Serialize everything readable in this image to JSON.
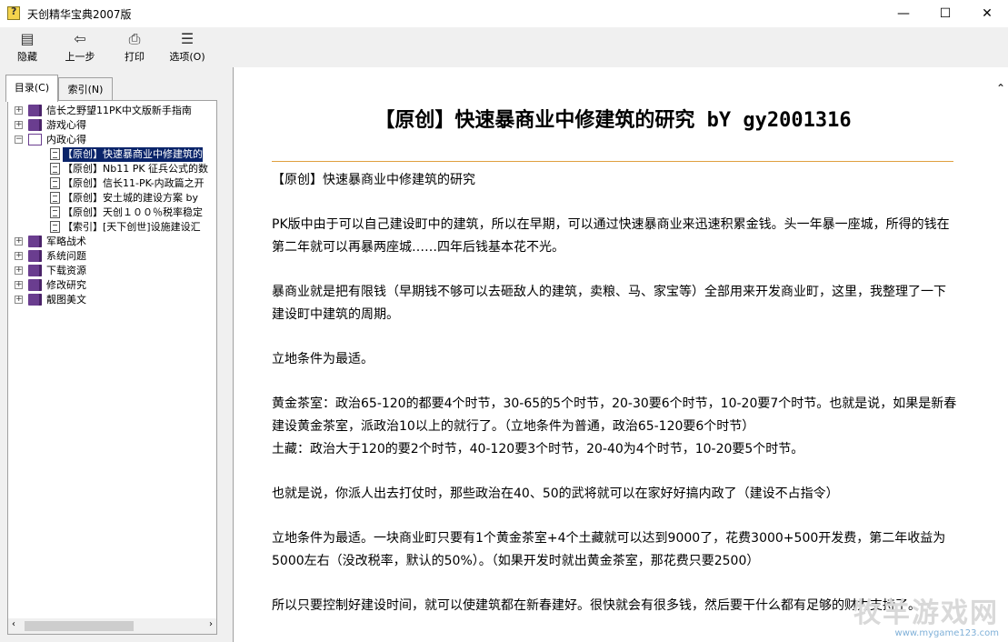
{
  "window": {
    "title": "天创精华宝典2007版",
    "minimize": "—",
    "maximize": "☐",
    "close": "✕"
  },
  "toolbar": [
    {
      "label": "隐藏",
      "icon": "hide-icon",
      "glyph": "▤"
    },
    {
      "label": "上一步",
      "icon": "back-icon",
      "glyph": "⇦"
    },
    {
      "label": "打印",
      "icon": "print-icon",
      "glyph": "⎙"
    },
    {
      "label": "选项(O)",
      "icon": "options-icon",
      "glyph": "☰"
    }
  ],
  "tabs": {
    "contents": "目录(C)",
    "index": "索引(N)"
  },
  "tree": [
    {
      "label": "信长之野望11PK中文版新手指南",
      "type": "book",
      "expanded": false,
      "level": 0
    },
    {
      "label": "游戏心得",
      "type": "book",
      "expanded": false,
      "level": 0
    },
    {
      "label": "内政心得",
      "type": "book",
      "expanded": true,
      "level": 0
    },
    {
      "label": "【原创】快速暴商业中修建筑的",
      "type": "page",
      "level": 1,
      "selected": true
    },
    {
      "label": "【原创】Nb11 PK 征兵公式的数",
      "type": "page",
      "level": 1
    },
    {
      "label": "【原创】信长11-PK-内政篇之开",
      "type": "page",
      "level": 1
    },
    {
      "label": "【原创】安土城的建设方案 by",
      "type": "page",
      "level": 1
    },
    {
      "label": "【原创】天创１００％税率稳定",
      "type": "page",
      "level": 1
    },
    {
      "label": "【索引】[天下创世]设施建设汇",
      "type": "page",
      "level": 1
    },
    {
      "label": "军略战术",
      "type": "book",
      "expanded": false,
      "level": 0
    },
    {
      "label": "系统问题",
      "type": "book",
      "expanded": false,
      "level": 0
    },
    {
      "label": "下载资源",
      "type": "book",
      "expanded": false,
      "level": 0
    },
    {
      "label": "修改研究",
      "type": "book",
      "expanded": false,
      "level": 0
    },
    {
      "label": "靓图美文",
      "type": "book",
      "expanded": false,
      "level": 0
    }
  ],
  "article": {
    "title": "【原创】快速暴商业中修建筑的研究 bY gy2001316",
    "paragraphs": [
      "【原创】快速暴商业中修建筑的研究",
      "PK版中由于可以自己建设町中的建筑，所以在早期，可以通过快速暴商业来迅速积累金钱。头一年暴一座城，所得的钱在第二年就可以再暴两座城……四年后钱基本花不光。",
      "暴商业就是把有限钱（早期钱不够可以去砸敌人的建筑，卖粮、马、家宝等）全部用来开发商业町，这里，我整理了一下建设町中建筑的周期。",
      "立地条件为最适。",
      "黄金茶室：政治65-120的都要4个时节，30-65的5个时节，20-30要6个时节，10-20要7个时节。也就是说，如果是新春建设黄金茶室，派政治10以上的就行了。（立地条件为普通，政治65-120要6个时节）\n土藏：政治大于120的要2个时节，40-120要3个时节，20-40为4个时节，10-20要5个时节。",
      "也就是说，你派人出去打仗时，那些政治在40、50的武将就可以在家好好搞内政了（建设不占指令）",
      "立地条件为最适。一块商业町只要有1个黄金茶室+4个土藏就可以达到9000了，花费3000+500开发费，第二年收益为5000左右（没改税率，默认的50%）。（如果开发时就出黄金茶室，那花费只要2500）",
      "所以只要控制好建设时间，就可以使建筑都在新春建好。很快就会有很多钱，然后要干什么都有足够的财力支持了。"
    ]
  },
  "watermark": {
    "main": "牧羊游戏网",
    "url": "www.mygame123.com"
  }
}
